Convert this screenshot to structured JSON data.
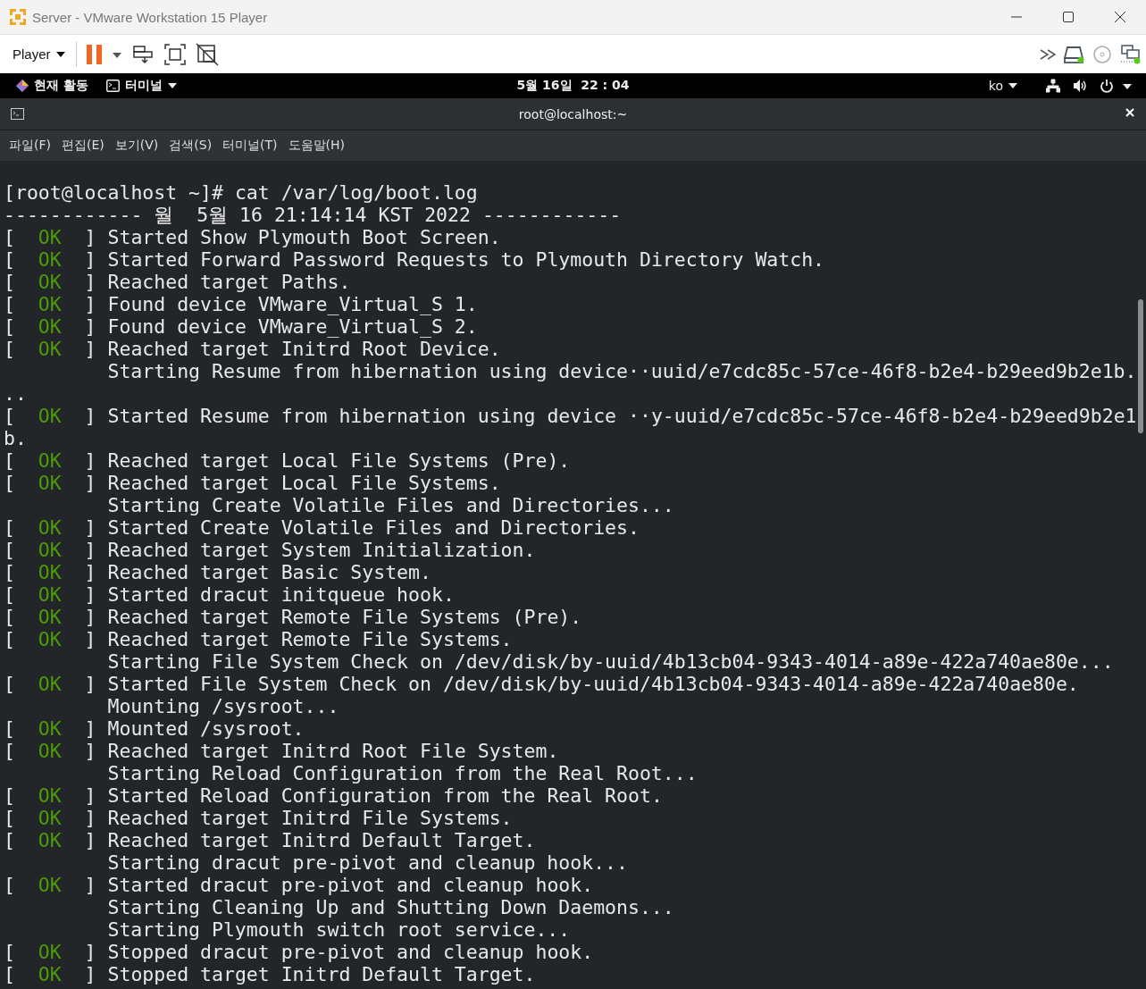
{
  "window": {
    "title": "Server - VMware Workstation 15 Player"
  },
  "toolbar": {
    "menu": "Player"
  },
  "topbar": {
    "activities": "현재 활동",
    "app": "터미널",
    "clock": "5월 16일  22 : 04",
    "input_method": "ko"
  },
  "terminal": {
    "title": "root@localhost:~",
    "menu": [
      "파일(F)",
      "편집(E)",
      "보기(V)",
      "검색(S)",
      "터미널(T)",
      "도움말(H)"
    ],
    "lines": [
      {
        "kind": "plain",
        "text": "[root@localhost ~]# cat /var/log/boot.log"
      },
      {
        "kind": "plain",
        "text": "------------ 월  5월 16 21:14:14 KST 2022 ------------"
      },
      {
        "kind": "ok",
        "open": "[",
        "status": "OK",
        "close": "]",
        "text": "Started Show Plymouth Boot Screen."
      },
      {
        "kind": "ok",
        "open": "[",
        "status": "OK",
        "close": "]",
        "text": "Started Forward Password Requests to Plymouth Directory Watch."
      },
      {
        "kind": "ok",
        "open": "[",
        "status": "OK",
        "close": "]",
        "text": "Reached target Paths."
      },
      {
        "kind": "ok",
        "open": "[",
        "status": "OK",
        "close": "]",
        "text": "Found device VMware_Virtual_S 1."
      },
      {
        "kind": "ok",
        "open": "[",
        "status": "OK",
        "close": "]",
        "text": "Found device VMware_Virtual_S 2."
      },
      {
        "kind": "ok",
        "open": "[",
        "status": "OK",
        "close": "]",
        "text": "Reached target Initrd Root Device."
      },
      {
        "kind": "job",
        "text": "Starting Resume from hibernation using device··uuid/e7cdc85c-57ce-46f8-b2e4-b29eed9b2e1b."
      },
      {
        "kind": "plain",
        "text": ".."
      },
      {
        "kind": "ok",
        "open": "[",
        "status": "OK",
        "close": "]",
        "text": "Started Resume from hibernation using device ··y-uuid/e7cdc85c-57ce-46f8-b2e4-b29eed9b2e1"
      },
      {
        "kind": "plain",
        "text": "b."
      },
      {
        "kind": "ok",
        "open": "[",
        "status": "OK",
        "close": "]",
        "text": "Reached target Local File Systems (Pre)."
      },
      {
        "kind": "ok",
        "open": "[",
        "status": "OK",
        "close": "]",
        "text": "Reached target Local File Systems."
      },
      {
        "kind": "job",
        "text": "Starting Create Volatile Files and Directories..."
      },
      {
        "kind": "ok",
        "open": "[",
        "status": "OK",
        "close": "]",
        "text": "Started Create Volatile Files and Directories."
      },
      {
        "kind": "ok",
        "open": "[",
        "status": "OK",
        "close": "]",
        "text": "Reached target System Initialization."
      },
      {
        "kind": "ok",
        "open": "[",
        "status": "OK",
        "close": "]",
        "text": "Reached target Basic System."
      },
      {
        "kind": "ok",
        "open": "[",
        "status": "OK",
        "close": "]",
        "text": "Started dracut initqueue hook."
      },
      {
        "kind": "ok",
        "open": "[",
        "status": "OK",
        "close": "]",
        "text": "Reached target Remote File Systems (Pre)."
      },
      {
        "kind": "ok",
        "open": "[",
        "status": "OK",
        "close": "]",
        "text": "Reached target Remote File Systems."
      },
      {
        "kind": "job",
        "text": "Starting File System Check on /dev/disk/by-uuid/4b13cb04-9343-4014-a89e-422a740ae80e..."
      },
      {
        "kind": "ok",
        "open": "[",
        "status": "OK",
        "close": "]",
        "text": "Started File System Check on /dev/disk/by-uuid/4b13cb04-9343-4014-a89e-422a740ae80e."
      },
      {
        "kind": "job",
        "text": "Mounting /sysroot..."
      },
      {
        "kind": "ok",
        "open": "[",
        "status": "OK",
        "close": "]",
        "text": "Mounted /sysroot."
      },
      {
        "kind": "ok",
        "open": "[",
        "status": "OK",
        "close": "]",
        "text": "Reached target Initrd Root File System."
      },
      {
        "kind": "job",
        "text": "Starting Reload Configuration from the Real Root..."
      },
      {
        "kind": "ok",
        "open": "[",
        "status": "OK",
        "close": "]",
        "text": "Started Reload Configuration from the Real Root."
      },
      {
        "kind": "ok",
        "open": "[",
        "status": "OK",
        "close": "]",
        "text": "Reached target Initrd File Systems."
      },
      {
        "kind": "ok",
        "open": "[",
        "status": "OK",
        "close": "]",
        "text": "Reached target Initrd Default Target."
      },
      {
        "kind": "job",
        "text": "Starting dracut pre-pivot and cleanup hook..."
      },
      {
        "kind": "ok",
        "open": "[",
        "status": "OK",
        "close": "]",
        "text": "Started dracut pre-pivot and cleanup hook."
      },
      {
        "kind": "job",
        "text": "Starting Cleaning Up and Shutting Down Daemons..."
      },
      {
        "kind": "job",
        "text": "Starting Plymouth switch root service..."
      },
      {
        "kind": "ok",
        "open": "[",
        "status": "OK",
        "close": "]",
        "text": "Stopped dracut pre-pivot and cleanup hook."
      },
      {
        "kind": "ok",
        "open": "[",
        "status": "OK",
        "close": "]",
        "text": "Stopped target Initrd Default Target."
      }
    ]
  }
}
